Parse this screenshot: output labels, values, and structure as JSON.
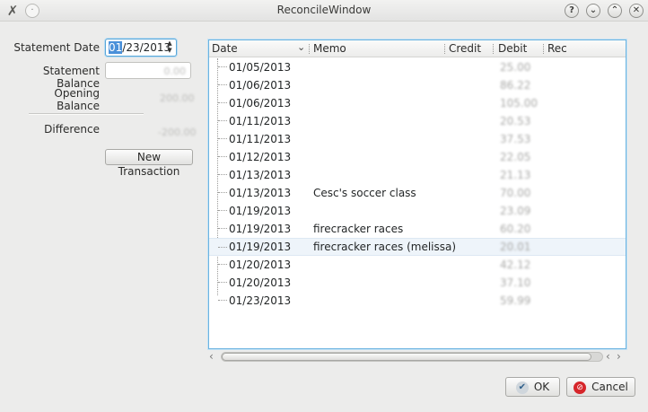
{
  "window": {
    "title": "ReconcileWindow"
  },
  "titlebar": {
    "help_icon": "?",
    "minimize_icon": "⌄",
    "maximize_icon": "⌃",
    "close_icon": "✕"
  },
  "form": {
    "statement_date_label": "Statement Date",
    "statement_date_sel": "01",
    "statement_date_rest": "/23/2013",
    "statement_balance_label": "Statement Balance",
    "statement_balance_value": "0.00",
    "opening_balance_label": "Opening Balance",
    "opening_balance_value": "200.00",
    "difference_label": "Difference",
    "difference_value": "-200.00",
    "new_transaction_label": "New Transaction"
  },
  "table": {
    "headers": {
      "date": "Date",
      "memo": "Memo",
      "credit": "Credit",
      "debit": "Debit",
      "rec": "Rec"
    },
    "rows": [
      {
        "date": "01/05/2013",
        "memo": "",
        "debit": "25.00"
      },
      {
        "date": "01/06/2013",
        "memo": "",
        "debit": "86.22"
      },
      {
        "date": "01/06/2013",
        "memo": "",
        "debit": "105.00"
      },
      {
        "date": "01/11/2013",
        "memo": "",
        "debit": "20.53"
      },
      {
        "date": "01/11/2013",
        "memo": "",
        "debit": "37.53"
      },
      {
        "date": "01/12/2013",
        "memo": "",
        "debit": "22.05"
      },
      {
        "date": "01/13/2013",
        "memo": "",
        "debit": "21.13"
      },
      {
        "date": "01/13/2013",
        "memo": "Cesc's soccer class",
        "debit": "70.00"
      },
      {
        "date": "01/19/2013",
        "memo": "",
        "debit": "23.09"
      },
      {
        "date": "01/19/2013",
        "memo": "firecracker races",
        "debit": "60.20"
      },
      {
        "date": "01/19/2013",
        "memo": "firecracker races (melissa)",
        "debit": "20.01"
      },
      {
        "date": "01/20/2013",
        "memo": "",
        "debit": "42.12"
      },
      {
        "date": "01/20/2013",
        "memo": "",
        "debit": "37.10"
      },
      {
        "date": "01/23/2013",
        "memo": "",
        "debit": "59.99"
      }
    ]
  },
  "buttons": {
    "ok_label": "OK",
    "cancel_label": "Cancel"
  }
}
